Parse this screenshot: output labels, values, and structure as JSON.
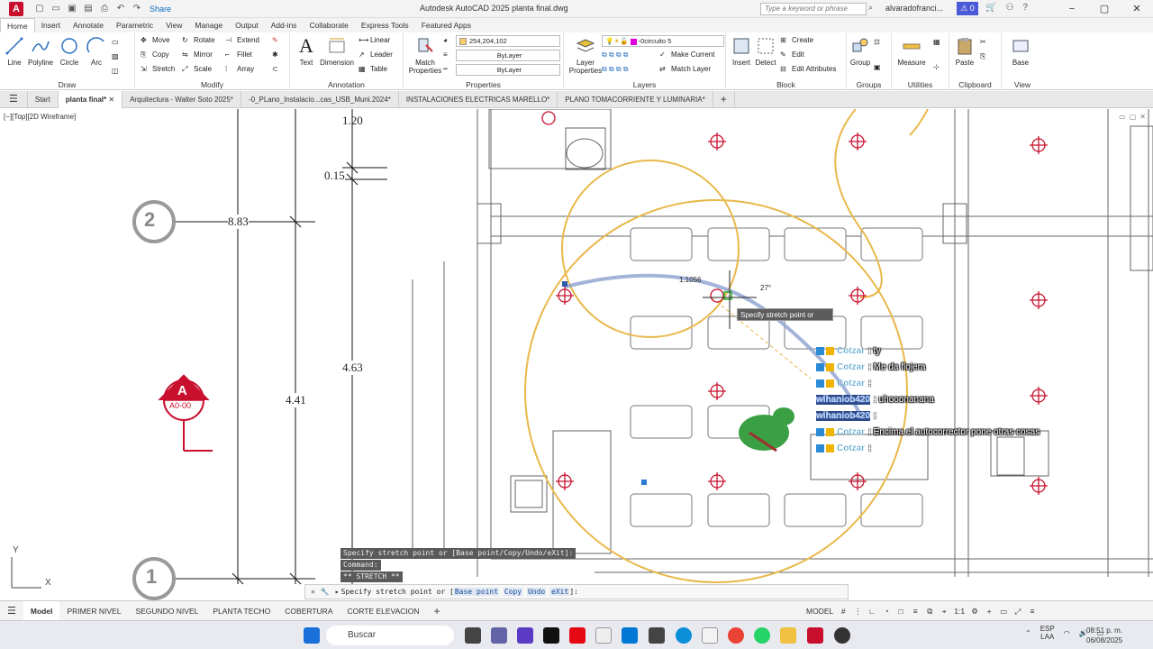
{
  "window": {
    "title": "Autodesk AutoCAD 2025    planta final.dwg",
    "app_letter": "A",
    "share": "Share",
    "search_placeholder": "Type a keyword or phrase",
    "user": "alvaradofranci...",
    "notif_count": "0"
  },
  "ribbon_tabs": [
    "Home",
    "Insert",
    "Annotate",
    "Parametric",
    "View",
    "Manage",
    "Output",
    "Add-ins",
    "Collaborate",
    "Express Tools",
    "Featured Apps"
  ],
  "draw": {
    "title": "Draw",
    "line": "Line",
    "polyline": "Polyline",
    "circle": "Circle",
    "arc": "Arc"
  },
  "modify": {
    "title": "Modify",
    "move": "Move",
    "rotate": "Rotate",
    "extend": "Extend",
    "copy": "Copy",
    "mirror": "Mirror",
    "fillet": "Fillet",
    "stretch": "Stretch",
    "scale": "Scale",
    "array": "Array"
  },
  "annotation": {
    "title": "Annotation",
    "text": "Text",
    "dimension": "Dimension",
    "linear": "Linear",
    "leader": "Leader",
    "table": "Table"
  },
  "properties": {
    "title": "Properties",
    "match": "Match Properties",
    "color_value": "254,204,102",
    "linetype": "ByLayer",
    "lineweight": "ByLayer"
  },
  "layers": {
    "title": "Layers",
    "layer_props": "Layer Properties",
    "current_layer": "-0circuito 5",
    "make_current": "Make Current",
    "match_layer": "Match Layer"
  },
  "block": {
    "title": "Block",
    "insert": "Insert",
    "detect": "Detect",
    "create": "Create",
    "edit": "Edit",
    "edit_attr": "Edit Attributes"
  },
  "groups": {
    "title": "Groups",
    "group": "Group"
  },
  "utilities": {
    "title": "Utilities",
    "measure": "Measure"
  },
  "clipboard": {
    "title": "Clipboard",
    "paste": "Paste"
  },
  "view_panel": {
    "title": "View",
    "base": "Base"
  },
  "file_tabs": [
    "Start",
    "planta final*",
    "Arquitectura - Walter Soto 2025*",
    "-0_PLano_Instalacio...cas_USB_Muni.2024*",
    "INSTALACIONES ELECTRICAS MARELLO*",
    "PLANO TOMACORRIENTE Y LUMINARIA*"
  ],
  "viewport_label": "[−][Top][2D Wireframe]",
  "dims": {
    "d1": "1.20",
    "d2": "0.15",
    "d3": "8.83",
    "d4": "4.63",
    "d5": "4.41",
    "radius": "1.1056",
    "angle": "27°"
  },
  "markers": {
    "m2": "2",
    "m1": "1",
    "sectionA": "A",
    "sectionRef": "A0-00"
  },
  "ucs": {
    "y": "Y",
    "x": "X"
  },
  "tooltip": "Specify stretch point or",
  "chat": [
    {
      "name": "Cotzar",
      "msg": ": ty"
    },
    {
      "name": "Cotzar",
      "msg": ": Me da flojera"
    },
    {
      "name": "Cotzar",
      "msg": ":"
    },
    {
      "name": "wihaniob420",
      "msg": ": uhooonanana"
    },
    {
      "name": "wihaniob420",
      "msg": ":"
    },
    {
      "name": "Cotzar",
      "msg": ": Encima el autocorrector pone otras cosas"
    },
    {
      "name": "Cotzar",
      "msg": ":"
    }
  ],
  "cmd_history": [
    "Specify stretch point or [Base point/Copy/Undo/eXit]:",
    "Command:",
    "** STRETCH **"
  ],
  "cmdline": {
    "prefix": "Specify stretch point or [",
    "opt1": "Base point",
    "opt2": "Copy",
    "opt3": "Undo",
    "opt4": "eXit",
    "suffix": "]:"
  },
  "layout_tabs": [
    "Model",
    "PRIMER NIVEL",
    "SEGUNDO NIVEL",
    "PLANTA TECHO",
    "COBERTURA",
    "CORTE ELEVACION"
  ],
  "status": {
    "model": "MODEL",
    "scale": "1:1"
  },
  "taskbar": {
    "search": "Buscar",
    "lang1": "ESP",
    "lang2": "LAA",
    "time": "08:51 p. m.",
    "date": "06/08/2025"
  }
}
